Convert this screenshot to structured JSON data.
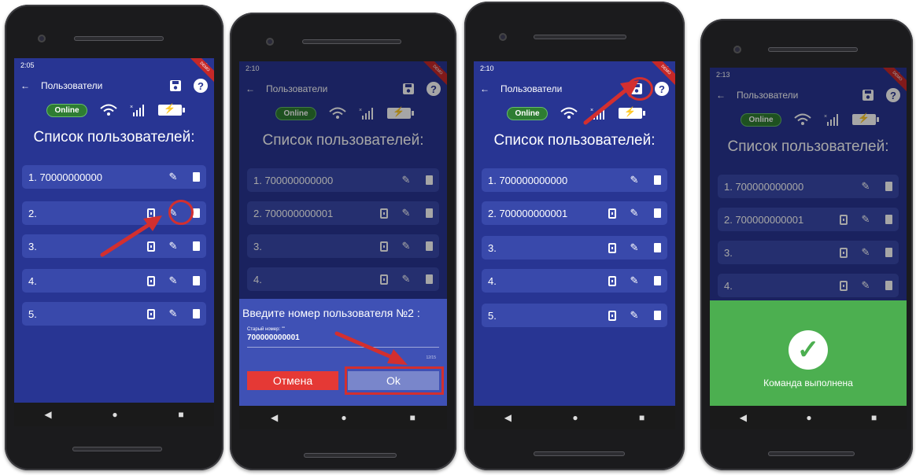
{
  "colors": {
    "app_bg": "#283593",
    "row_bg": "#3949ab",
    "accent_red": "#d32f2f",
    "success_green": "#4caf50",
    "online_green": "#2e7d32"
  },
  "screens": [
    {
      "time": "2:05",
      "title": "Пользователи",
      "online_badge": "Online",
      "heading": "Список пользователей:",
      "rows": [
        {
          "label": "1. 70000000000"
        },
        {
          "label": "2."
        },
        {
          "label": "3."
        },
        {
          "label": "4."
        },
        {
          "label": "5."
        }
      ]
    },
    {
      "time": "2:10",
      "title": "Пользователи",
      "online_badge": "Online",
      "heading": "Список пользователей:",
      "rows": [
        {
          "label": "1. 700000000000"
        },
        {
          "label": "2. 700000000001"
        },
        {
          "label": "3."
        },
        {
          "label": "4."
        }
      ],
      "dialog": {
        "question": "Введите номер пользователя №2 :",
        "hint": "Старый номер: \"\"",
        "value": "700000000001",
        "counter": "12/15",
        "cancel_label": "Отмена",
        "ok_label": "Ok"
      }
    },
    {
      "time": "2:10",
      "title": "Пользователи",
      "online_badge": "Online",
      "heading": "Список пользователей:",
      "rows": [
        {
          "label": "1. 700000000000"
        },
        {
          "label": "2. 700000000001"
        },
        {
          "label": "3."
        },
        {
          "label": "4."
        },
        {
          "label": "5."
        }
      ]
    },
    {
      "time": "2:13",
      "title": "Пользователи",
      "online_badge": "Online",
      "heading": "Список пользователей:",
      "rows": [
        {
          "label": "1. 700000000000"
        },
        {
          "label": "2. 700000000001"
        },
        {
          "label": "3."
        },
        {
          "label": "4."
        }
      ],
      "toast": "Команда выполнена"
    }
  ],
  "icons": {
    "back": "arrow-left-icon",
    "save": "save-icon",
    "help": "help-icon",
    "wifi": "wifi-icon",
    "signal": "signal-icon",
    "battery": "battery-charging-icon",
    "sim": "sim-card-icon",
    "edit": "pencil-icon",
    "delete": "trash-icon",
    "success": "checkmark-icon"
  },
  "navbar": {
    "back": "◀",
    "home": "●",
    "recents": "■"
  },
  "ribbon": "DEMO"
}
